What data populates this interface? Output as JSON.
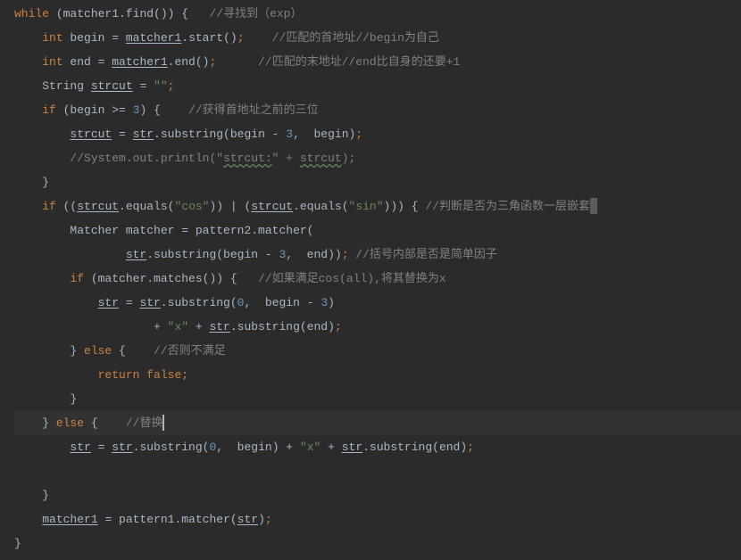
{
  "code": {
    "lines": [
      {
        "indent": 0,
        "segs": [
          {
            "t": "while",
            "c": "kw"
          },
          {
            "t": " (matcher1.",
            "c": "ident"
          },
          {
            "t": "find()",
            "c": "ident"
          },
          {
            "t": ") {   ",
            "c": "ident"
          },
          {
            "t": "//寻找到（exp）",
            "c": "comment"
          }
        ]
      },
      {
        "indent": 1,
        "segs": [
          {
            "t": "int",
            "c": "kw"
          },
          {
            "t": " begin = ",
            "c": "ident"
          },
          {
            "t": "matcher1",
            "c": "underline"
          },
          {
            "t": ".start()",
            "c": "ident"
          },
          {
            "t": ";",
            "c": "punct cc"
          },
          {
            "t": "    ",
            "c": ""
          },
          {
            "t": "//匹配的首地址//begin为自己",
            "c": "comment"
          }
        ]
      },
      {
        "indent": 1,
        "segs": [
          {
            "t": "int",
            "c": "kw"
          },
          {
            "t": " end = ",
            "c": "ident"
          },
          {
            "t": "matcher1",
            "c": "underline"
          },
          {
            "t": ".end()",
            "c": "ident"
          },
          {
            "t": ";",
            "c": "punct cc"
          },
          {
            "t": "      ",
            "c": ""
          },
          {
            "t": "//匹配的末地址//end比自身的还要+1",
            "c": "comment"
          }
        ]
      },
      {
        "indent": 1,
        "segs": [
          {
            "t": "String ",
            "c": "ident"
          },
          {
            "t": "strcut",
            "c": "underline"
          },
          {
            "t": " = ",
            "c": "ident"
          },
          {
            "t": "\"\"",
            "c": "string"
          },
          {
            "t": ";",
            "c": "punct cc"
          }
        ]
      },
      {
        "indent": 1,
        "segs": [
          {
            "t": "if",
            "c": "kw"
          },
          {
            "t": " (begin >= ",
            "c": "ident"
          },
          {
            "t": "3",
            "c": "num"
          },
          {
            "t": ") {    ",
            "c": "ident"
          },
          {
            "t": "//获得首地址之前的三位",
            "c": "comment"
          }
        ]
      },
      {
        "indent": 2,
        "segs": [
          {
            "t": "strcut",
            "c": "underline"
          },
          {
            "t": " = ",
            "c": "ident"
          },
          {
            "t": "str",
            "c": "underline"
          },
          {
            "t": ".substring(begin - ",
            "c": "ident"
          },
          {
            "t": "3",
            "c": "num"
          },
          {
            "t": ",  begin)",
            "c": "ident"
          },
          {
            "t": ";",
            "c": "punct cc"
          }
        ]
      },
      {
        "indent": 2,
        "segs": [
          {
            "t": "//System.out.println(\"",
            "c": "comment"
          },
          {
            "t": "strcut:",
            "c": "wavy comment"
          },
          {
            "t": "\" + ",
            "c": "comment"
          },
          {
            "t": "strcut",
            "c": "wavy comment"
          },
          {
            "t": ");",
            "c": "comment"
          }
        ]
      },
      {
        "indent": 1,
        "segs": [
          {
            "t": "}",
            "c": "ident"
          }
        ]
      },
      {
        "indent": 1,
        "segs": [
          {
            "t": "if",
            "c": "kw"
          },
          {
            "t": " ((",
            "c": "ident"
          },
          {
            "t": "strcut",
            "c": "underline"
          },
          {
            "t": ".equals(",
            "c": "ident"
          },
          {
            "t": "\"cos\"",
            "c": "string"
          },
          {
            "t": ")) | (",
            "c": "ident"
          },
          {
            "t": "strcut",
            "c": "underline"
          },
          {
            "t": ".equals(",
            "c": "ident"
          },
          {
            "t": "\"sin\"",
            "c": "string"
          },
          {
            "t": "))) { ",
            "c": "ident"
          },
          {
            "t": "//判断是否为三角函数一层嵌套",
            "c": "comment"
          },
          {
            "t": "",
            "c": "",
            "caretblock": true
          }
        ]
      },
      {
        "indent": 2,
        "segs": [
          {
            "t": "Matcher matcher = pattern2.matcher(",
            "c": "ident"
          }
        ]
      },
      {
        "indent": 4,
        "segs": [
          {
            "t": "str",
            "c": "underline"
          },
          {
            "t": ".substring(begin - ",
            "c": "ident"
          },
          {
            "t": "3",
            "c": "num"
          },
          {
            "t": ",  end))",
            "c": "ident"
          },
          {
            "t": ";",
            "c": "punct cc"
          },
          {
            "t": " ",
            "c": ""
          },
          {
            "t": "//括号内部是否是简单因子",
            "c": "comment"
          }
        ]
      },
      {
        "indent": 2,
        "segs": [
          {
            "t": "if",
            "c": "kw"
          },
          {
            "t": " (matcher.matches()) {   ",
            "c": "ident"
          },
          {
            "t": "//如果满足cos(all),将其替换为x",
            "c": "comment"
          }
        ]
      },
      {
        "indent": 3,
        "segs": [
          {
            "t": "str",
            "c": "underline"
          },
          {
            "t": " = ",
            "c": "ident"
          },
          {
            "t": "str",
            "c": "underline"
          },
          {
            "t": ".substring(",
            "c": "ident"
          },
          {
            "t": "0",
            "c": "num"
          },
          {
            "t": ",  begin - ",
            "c": "ident"
          },
          {
            "t": "3",
            "c": "num"
          },
          {
            "t": ")",
            "c": "ident"
          }
        ]
      },
      {
        "indent": 5,
        "segs": [
          {
            "t": "+ ",
            "c": "ident"
          },
          {
            "t": "\"x\"",
            "c": "string"
          },
          {
            "t": " + ",
            "c": "ident"
          },
          {
            "t": "str",
            "c": "underline"
          },
          {
            "t": ".substring(end)",
            "c": "ident"
          },
          {
            "t": ";",
            "c": "punct cc"
          }
        ]
      },
      {
        "indent": 2,
        "segs": [
          {
            "t": "} ",
            "c": "ident"
          },
          {
            "t": "else",
            "c": "kw"
          },
          {
            "t": " {    ",
            "c": "ident"
          },
          {
            "t": "//否则不满足",
            "c": "comment"
          }
        ]
      },
      {
        "indent": 3,
        "segs": [
          {
            "t": "return false",
            "c": "kw"
          },
          {
            "t": ";",
            "c": "punct cc"
          }
        ]
      },
      {
        "indent": 2,
        "segs": [
          {
            "t": "}",
            "c": "ident"
          }
        ]
      },
      {
        "indent": 1,
        "hl": true,
        "segs": [
          {
            "t": "} ",
            "c": "ident"
          },
          {
            "t": "else",
            "c": "kw"
          },
          {
            "t": " {    ",
            "c": "ident"
          },
          {
            "t": "//替换",
            "c": "comment"
          },
          {
            "t": "",
            "c": "",
            "caret": true
          }
        ]
      },
      {
        "indent": 2,
        "segs": [
          {
            "t": "str",
            "c": "underline"
          },
          {
            "t": " = ",
            "c": "ident"
          },
          {
            "t": "str",
            "c": "underline"
          },
          {
            "t": ".substring(",
            "c": "ident"
          },
          {
            "t": "0",
            "c": "num"
          },
          {
            "t": ",  begin) + ",
            "c": "ident"
          },
          {
            "t": "\"x\"",
            "c": "string"
          },
          {
            "t": " + ",
            "c": "ident"
          },
          {
            "t": "str",
            "c": "underline"
          },
          {
            "t": ".substring(end)",
            "c": "ident"
          },
          {
            "t": ";",
            "c": "punct cc"
          }
        ]
      },
      {
        "indent": 2,
        "segs": []
      },
      {
        "indent": 1,
        "segs": [
          {
            "t": "}",
            "c": "ident"
          }
        ]
      },
      {
        "indent": 1,
        "segs": [
          {
            "t": "matcher1",
            "c": "underline"
          },
          {
            "t": " = pattern1.matcher(",
            "c": "ident"
          },
          {
            "t": "str",
            "c": "underline"
          },
          {
            "t": ")",
            "c": "ident"
          },
          {
            "t": ";",
            "c": "punct cc"
          }
        ]
      },
      {
        "indent": 0,
        "segs": [
          {
            "t": "}",
            "c": "ident"
          }
        ]
      }
    ]
  },
  "indent_unit": "    ",
  "colors": {
    "keyword": "#cc8242",
    "identifier": "#a9b7c6",
    "comment": "#808080",
    "string": "#6a8759",
    "number": "#6897bb",
    "background": "#2b2b2b",
    "highlight_line": "#323232"
  }
}
